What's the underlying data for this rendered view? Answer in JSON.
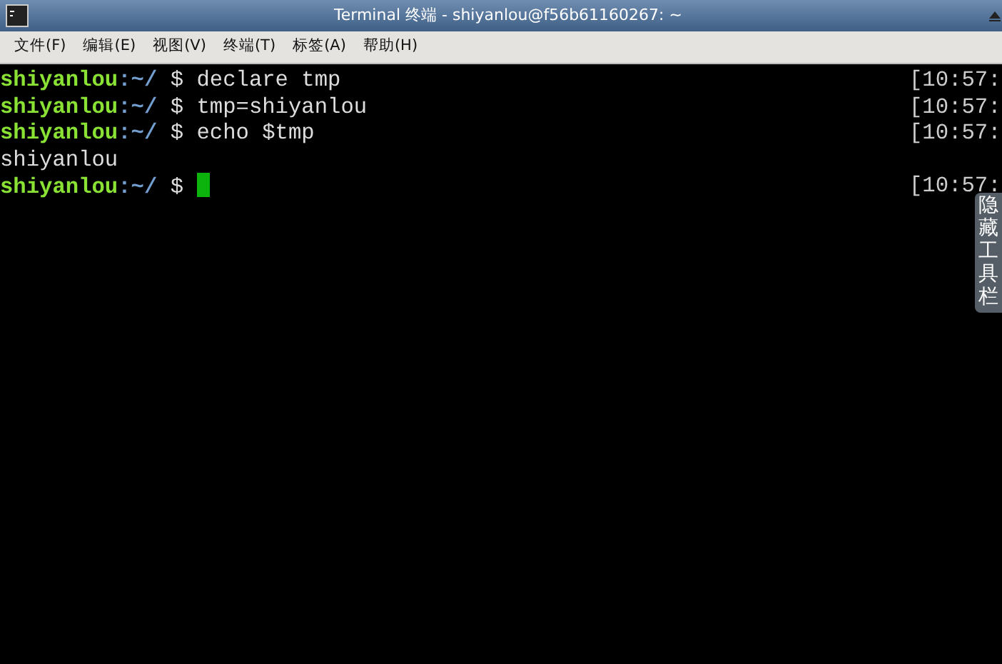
{
  "window": {
    "title": "Terminal 终端 - shiyanlou@f56b61160267: ~"
  },
  "menu": [
    "文件(F)",
    "编辑(E)",
    "视图(V)",
    "终端(T)",
    "标签(A)",
    "帮助(H)"
  ],
  "lines": [
    {
      "kind": "prompt",
      "user": "shiyanlou",
      "path": ":~/",
      "symbol": "$",
      "command": "declare tmp",
      "time": "[10:57:",
      "cursor": false
    },
    {
      "kind": "prompt",
      "user": "shiyanlou",
      "path": ":~/",
      "symbol": "$",
      "command": "tmp=shiyanlou",
      "time": "[10:57:",
      "cursor": false
    },
    {
      "kind": "prompt",
      "user": "shiyanlou",
      "path": ":~/",
      "symbol": "$",
      "command": "echo $tmp",
      "time": "[10:57:",
      "cursor": false
    },
    {
      "kind": "output",
      "text": "shiyanlou"
    },
    {
      "kind": "prompt",
      "user": "shiyanlou",
      "path": ":~/",
      "symbol": "$",
      "time": "[10:57:",
      "cursor": true
    }
  ],
  "side_panel": {
    "label": "隐藏工具栏"
  }
}
